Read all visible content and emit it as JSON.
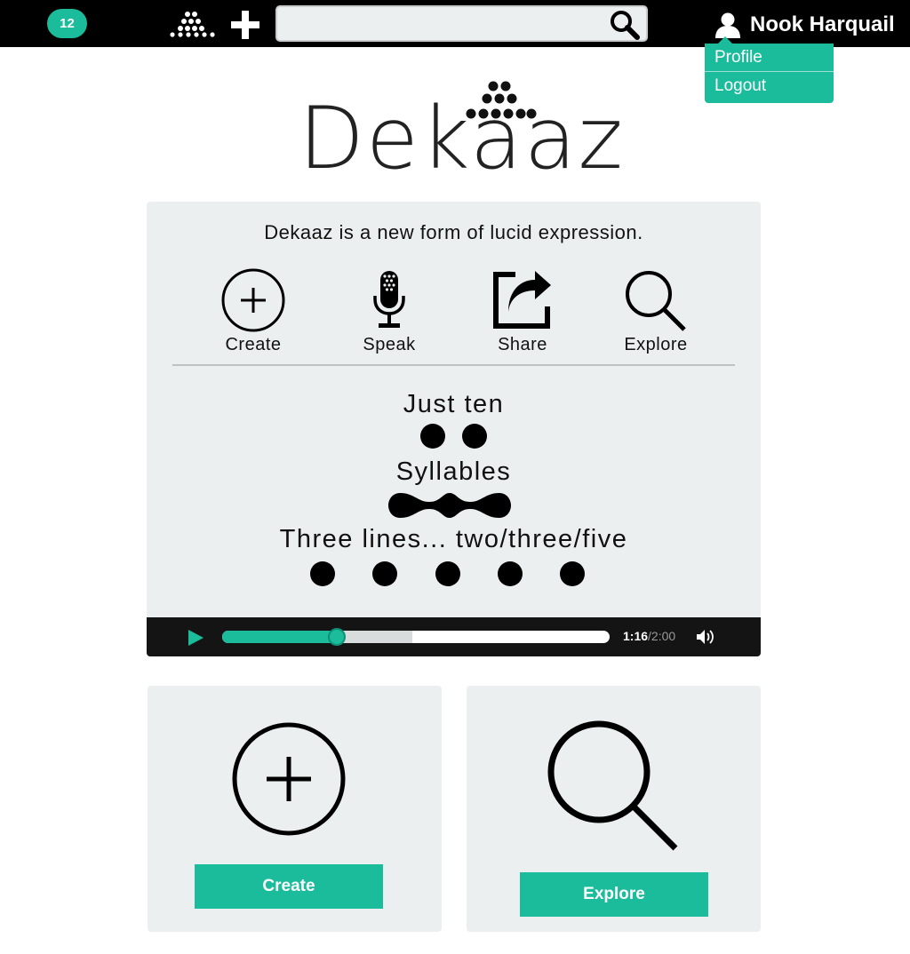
{
  "topbar": {
    "notification_count": "12",
    "search": {
      "placeholder": "",
      "value": ""
    },
    "user_name": "Nook Harquail"
  },
  "dropdown": {
    "items": [
      "Profile",
      "Logout"
    ]
  },
  "brand": {
    "name": "Dekaaz"
  },
  "intro": {
    "tagline": "Dekaaz is a new form of lucid expression.",
    "features": [
      {
        "label": "Create",
        "icon": "plus-circle-icon"
      },
      {
        "label": "Speak",
        "icon": "microphone-icon"
      },
      {
        "label": "Share",
        "icon": "share-icon"
      },
      {
        "label": "Explore",
        "icon": "magnifier-icon"
      }
    ],
    "rules": [
      {
        "text": "Just ten",
        "marks": "2 dots"
      },
      {
        "text": "Syllables",
        "marks": "wave"
      },
      {
        "text": "Three lines... two/three/five",
        "marks": "5 dots"
      }
    ]
  },
  "player": {
    "current_time": "1:16",
    "duration": "/2:00",
    "progress": 0.296,
    "buffered": 0.49
  },
  "cards": [
    {
      "label": "Create",
      "icon": "plus-circle-icon"
    },
    {
      "label": "Explore",
      "icon": "magnifier-icon"
    }
  ],
  "colors": {
    "accent": "#1bbc9b",
    "topbar": "#000000",
    "panel": "#eceff0"
  }
}
